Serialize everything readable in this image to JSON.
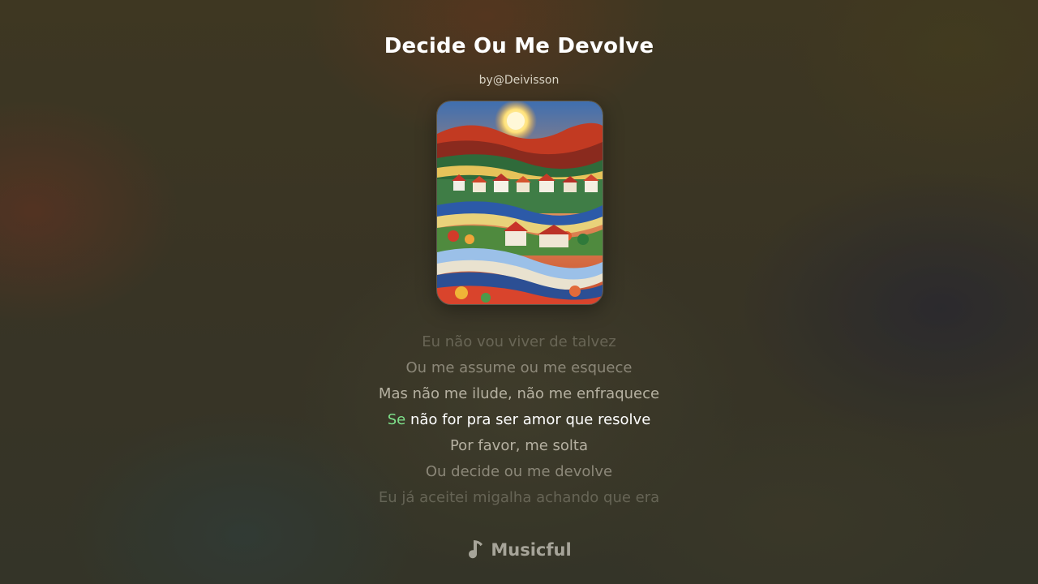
{
  "song": {
    "title": "Decide Ou Me Devolve",
    "artist": "by@Deivisson"
  },
  "cover": {
    "icon": "album-cover-art"
  },
  "lyrics": {
    "lines": [
      "Eu não vou viver de talvez",
      "Ou me assume ou me esquece",
      "Mas não me ilude, não me enfraquece",
      "não for pra ser amor que resolve",
      "Por favor, me solta",
      "Ou decide ou me devolve",
      "Eu já aceitei migalha achando que era"
    ],
    "active_sung": "Se"
  },
  "colors": {
    "sung_highlight": "#7ee08a",
    "active_text": "#ffffff"
  },
  "brand": {
    "name": "Musicful",
    "icon": "music-note-icon"
  }
}
